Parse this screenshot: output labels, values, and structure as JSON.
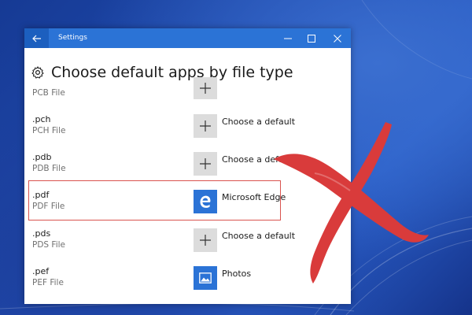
{
  "window": {
    "title": "Settings"
  },
  "page": {
    "title": "Choose default apps by file type"
  },
  "rows": [
    {
      "ext": "",
      "type": "PCB File",
      "app": "",
      "tile": "plus"
    },
    {
      "ext": ".pch",
      "type": "PCH File",
      "app": "Choose a default",
      "tile": "plus"
    },
    {
      "ext": ".pdb",
      "type": "PDB File",
      "app": "Choose a default",
      "tile": "plus"
    },
    {
      "ext": ".pdf",
      "type": "PDF File",
      "app": "Microsoft Edge",
      "tile": "edge"
    },
    {
      "ext": ".pds",
      "type": "PDS File",
      "app": "Choose a default",
      "tile": "plus"
    },
    {
      "ext": ".pef",
      "type": "PEF File",
      "app": "Photos",
      "tile": "photos"
    }
  ],
  "colors": {
    "titlebar": "#2b73d6",
    "accent": "#2b73d6",
    "highlight": "#d9534f",
    "cross": "#d93b3b"
  },
  "icons": {
    "back": "arrow-left-icon",
    "minimize": "minimize-icon",
    "maximize": "maximize-icon",
    "close": "close-icon",
    "gear": "gear-icon",
    "plus": "plus-icon",
    "edge": "edge-icon",
    "photos": "photos-icon"
  }
}
